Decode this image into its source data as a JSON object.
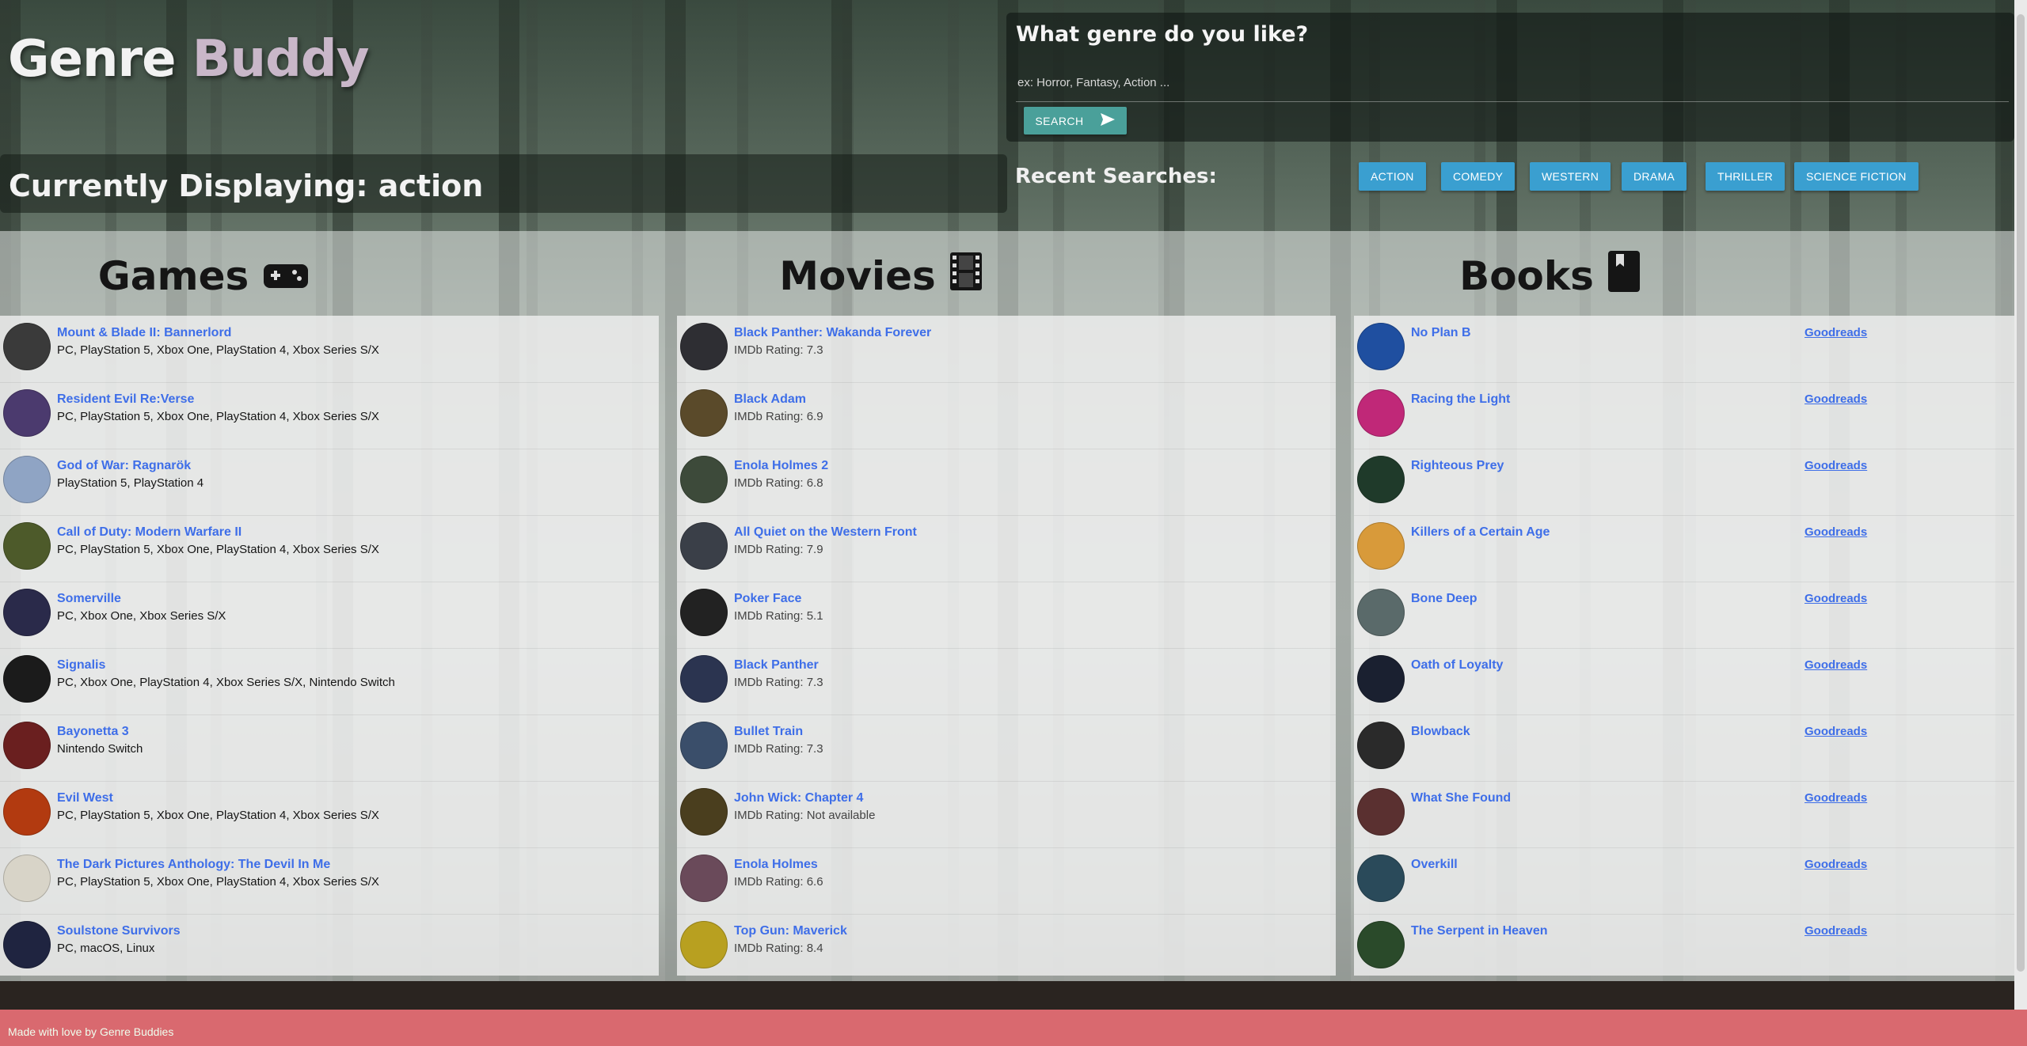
{
  "app": {
    "logo_part1": "Genre ",
    "logo_part2": "Buddy"
  },
  "display": {
    "title": "Currently Displaying: action"
  },
  "search": {
    "question": "What genre do you like?",
    "placeholder": "ex: Horror, Fantasy, Action ...",
    "value": "",
    "button_label": "SEARCH",
    "button_icon": "send-icon"
  },
  "recent": {
    "label": "Recent Searches:",
    "chips": [
      "ACTION",
      "COMEDY",
      "WESTERN",
      "DRAMA",
      "THRILLER",
      "SCIENCE FICTION"
    ]
  },
  "columns": {
    "games": {
      "heading": "Games",
      "icon": "gamepad-icon"
    },
    "movies": {
      "heading": "Movies",
      "icon": "film-icon"
    },
    "books": {
      "heading": "Books",
      "icon": "book-icon"
    }
  },
  "games": [
    {
      "title": "Mount & Blade II: Bannerlord",
      "platforms": "PC, PlayStation 5, Xbox One, PlayStation 4, Xbox Series S/X",
      "color": "#3a3a3a"
    },
    {
      "title": "Resident Evil Re:Verse",
      "platforms": "PC, PlayStation 5, Xbox One, PlayStation 4, Xbox Series S/X",
      "color": "#4b3a6e"
    },
    {
      "title": "God of War: Ragnarök",
      "platforms": "PlayStation 5, PlayStation 4",
      "color": "#8fa4c4"
    },
    {
      "title": "Call of Duty: Modern Warfare II",
      "platforms": "PC, PlayStation 5, Xbox One, PlayStation 4, Xbox Series S/X",
      "color": "#4d5a2a"
    },
    {
      "title": "Somerville",
      "platforms": "PC, Xbox One, Xbox Series S/X",
      "color": "#2a2a4a"
    },
    {
      "title": "Signalis",
      "platforms": "PC, Xbox One, PlayStation 4, Xbox Series S/X, Nintendo Switch",
      "color": "#1b1b1b"
    },
    {
      "title": "Bayonetta 3",
      "platforms": "Nintendo Switch",
      "color": "#6a1f1f"
    },
    {
      "title": "Evil West",
      "platforms": "PC, PlayStation 5, Xbox One, PlayStation 4, Xbox Series S/X",
      "color": "#b23a10"
    },
    {
      "title": "The Dark Pictures Anthology: The Devil In Me",
      "platforms": "PC, PlayStation 5, Xbox One, PlayStation 4, Xbox Series S/X",
      "color": "#d8d4c8"
    },
    {
      "title": "Soulstone Survivors",
      "platforms": "PC, macOS, Linux",
      "color": "#1f2440"
    }
  ],
  "movies": [
    {
      "title": "Black Panther: Wakanda Forever",
      "rating": "IMDb Rating: 7.3",
      "color": "#2e2e33"
    },
    {
      "title": "Black Adam",
      "rating": "IMDb Rating: 6.9",
      "color": "#5a4a2a"
    },
    {
      "title": "Enola Holmes 2",
      "rating": "IMDb Rating: 6.8",
      "color": "#3d4a3a"
    },
    {
      "title": "All Quiet on the Western Front",
      "rating": "IMDb Rating: 7.9",
      "color": "#3a3f48"
    },
    {
      "title": "Poker Face",
      "rating": "IMDb Rating: 5.1",
      "color": "#222222"
    },
    {
      "title": "Black Panther",
      "rating": "IMDb Rating: 7.3",
      "color": "#2b3450"
    },
    {
      "title": "Bullet Train",
      "rating": "IMDb Rating: 7.3",
      "color": "#3a4e6a"
    },
    {
      "title": "John Wick: Chapter 4",
      "rating": "IMDb Rating: Not available",
      "color": "#4a3e1e"
    },
    {
      "title": "Enola Holmes",
      "rating": "IMDb Rating: 6.6",
      "color": "#6a4a5a"
    },
    {
      "title": "Top Gun: Maverick",
      "rating": "IMDb Rating: 8.4",
      "color": "#b8a020"
    }
  ],
  "books": [
    {
      "title": "No Plan B",
      "link": "Goodreads",
      "color": "#1f4fa0"
    },
    {
      "title": "Racing the Light",
      "link": "Goodreads",
      "color": "#c02878"
    },
    {
      "title": "Righteous Prey",
      "link": "Goodreads",
      "color": "#1f3a2a"
    },
    {
      "title": "Killers of a Certain Age",
      "link": "Goodreads",
      "color": "#d89a3a"
    },
    {
      "title": "Bone Deep",
      "link": "Goodreads",
      "color": "#5a6a6a"
    },
    {
      "title": "Oath of Loyalty",
      "link": "Goodreads",
      "color": "#1a2030"
    },
    {
      "title": "Blowback",
      "link": "Goodreads",
      "color": "#2a2a2a"
    },
    {
      "title": "What She Found",
      "link": "Goodreads",
      "color": "#5a3030"
    },
    {
      "title": "Overkill",
      "link": "Goodreads",
      "color": "#2a4a5a"
    },
    {
      "title": "The Serpent in Heaven",
      "link": "Goodreads",
      "color": "#2a4a2a"
    }
  ],
  "footer": {
    "text": "Made with love by Genre Buddies"
  }
}
